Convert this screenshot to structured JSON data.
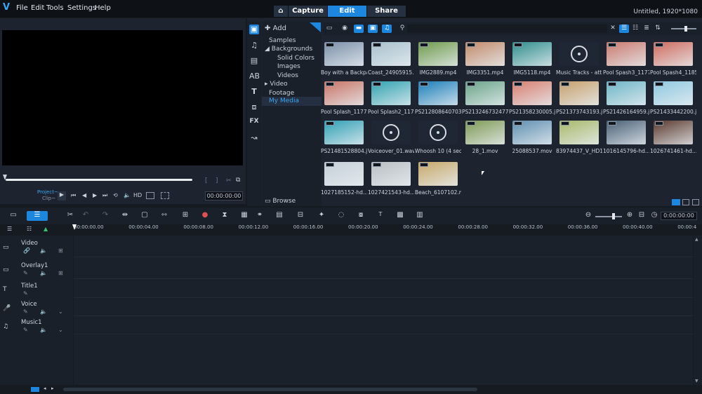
{
  "app": {
    "title": "Untitled, 1920*1080"
  },
  "menu": [
    "File",
    "Edit",
    "Tools",
    "Settings",
    "Help"
  ],
  "tabs": {
    "capture": "Capture",
    "edit": "Edit",
    "share": "Share"
  },
  "preview": {
    "project_label": "Project~",
    "clip_label": "Clip~",
    "hd": "HD",
    "timecode": "00:00:00:00"
  },
  "library": {
    "add": "Add",
    "browse": "Browse",
    "tree": [
      {
        "label": "Samples"
      },
      {
        "label": "Backgrounds"
      },
      {
        "label": "Solid Colors"
      },
      {
        "label": "Images"
      },
      {
        "label": "Videos"
      },
      {
        "label": "Video"
      },
      {
        "label": "Footage"
      },
      {
        "label": "My Media"
      }
    ],
    "items": [
      {
        "label": "Boy with a Backpa...",
        "color": "#7b8fa8"
      },
      {
        "label": "Coast_24905915...",
        "color": "#a7c0cc"
      },
      {
        "label": "IMG2889.mp4",
        "color": "#6f9a4c"
      },
      {
        "label": "IMG3351.mp4",
        "color": "#c28a6a"
      },
      {
        "label": "IMG5118.mp4",
        "color": "#2f8d8c"
      },
      {
        "label": "Music Tracks - att...",
        "color": "audio"
      },
      {
        "label": "Pool Spash3_1177...",
        "color": "#c97a6e"
      },
      {
        "label": "Pool Spash4_1185...",
        "color": "#cf6b5d"
      },
      {
        "label": "Pool Splash_1177...",
        "color": "#c87466"
      },
      {
        "label": "Pool Splash2_117...",
        "color": "#2fa2b0"
      },
      {
        "label": "PS212808640703...",
        "color": "#1a7db8"
      },
      {
        "label": "PS213246732477...",
        "color": "#6aa488"
      },
      {
        "label": "PS21358230005.j...",
        "color": "#d77f70"
      },
      {
        "label": "PS21373743193.j...",
        "color": "#c6a06d"
      },
      {
        "label": "PS21426164959.j...",
        "color": "#6db5c6"
      },
      {
        "label": "PS21433442200.j...",
        "color": "#8ec8e0"
      },
      {
        "label": "PS21481528804.j...",
        "color": "#2f9fb4"
      },
      {
        "label": "Voiceover_01.wav",
        "color": "audio"
      },
      {
        "label": "Whoosh 10 (4 sec...",
        "color": "audio"
      },
      {
        "label": "28_1.mov",
        "color": "#7f9a55"
      },
      {
        "label": "25088537.mov",
        "color": "#5f8fb0"
      },
      {
        "label": "83974437_V_HD1...",
        "color": "#a8b86a"
      },
      {
        "label": "1016145796-hd....",
        "color": "#4a6076"
      },
      {
        "label": "1026741461-hd....",
        "color": "#5b3a2e"
      },
      {
        "label": "1027185152-hd....",
        "color": "#c4cfd6"
      },
      {
        "label": "1027421543-hd....",
        "color": "#b9bec2"
      },
      {
        "label": "Beach_6107102.m...",
        "color": "#c7a869"
      }
    ]
  },
  "timeline": {
    "timecode": "0:00:00:00",
    "ruler": [
      "00:00:00.00",
      "00:00:04.00",
      "00:00:08.00",
      "00:00:12.00",
      "00:00:16.00",
      "00:00:20.00",
      "00:00:24.00",
      "00:00:28.00",
      "00:00:32.00",
      "00:00:36.00",
      "00:00:40.00",
      "00:00:4"
    ],
    "tracks": [
      {
        "label": "Video"
      },
      {
        "label": "Overlay1"
      },
      {
        "label": "Title1"
      },
      {
        "label": "Voice"
      },
      {
        "label": "Music1"
      }
    ]
  }
}
